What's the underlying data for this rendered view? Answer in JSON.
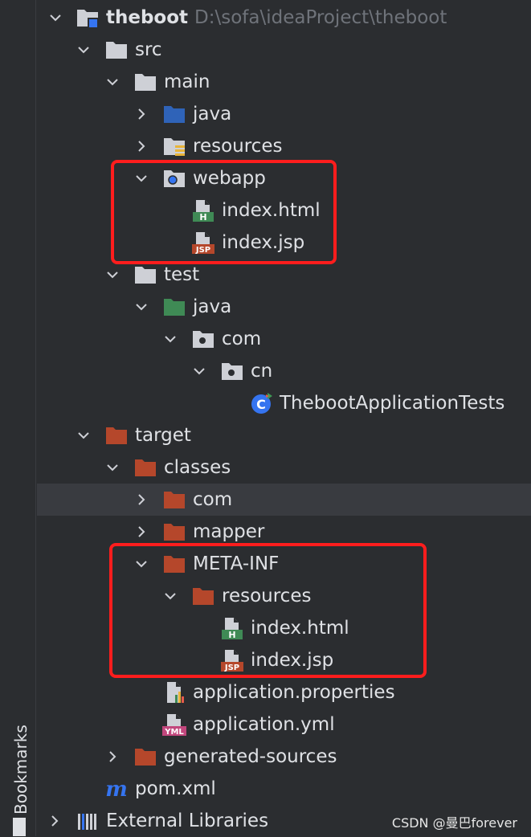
{
  "sidebar": {
    "label": "Bookmarks"
  },
  "project": {
    "name": "theboot",
    "path": "D:\\sofa\\ideaProject\\theboot"
  },
  "tree": {
    "src": "src",
    "main": "main",
    "main_java": "java",
    "resources": "resources",
    "webapp": "webapp",
    "webapp_index_html": "index.html",
    "webapp_index_jsp": "index.jsp",
    "test": "test",
    "test_java": "java",
    "com": "com",
    "cn": "cn",
    "test_class": "ThebootApplicationTests",
    "target": "target",
    "classes": "classes",
    "classes_com": "com",
    "mapper": "mapper",
    "meta_inf": "META-INF",
    "meta_resources": "resources",
    "meta_index_html": "index.html",
    "meta_index_jsp": "index.jsp",
    "app_properties": "application.properties",
    "app_yml": "application.yml",
    "generated_sources": "generated-sources",
    "pom": "pom.xml",
    "external_libraries": "External Libraries"
  },
  "icon_badges": {
    "html": "H",
    "jsp": "JSP",
    "yml": "YML",
    "maven": "m",
    "class": "C"
  },
  "watermark": "CSDN @曼巴forever",
  "colors": {
    "background": "#2b2d30",
    "selected_row": "#393b40",
    "text": "#dfe1e5",
    "path_text": "#6f737a",
    "folder_gray": "#ced0d6",
    "folder_source_blue": "#2f63b8",
    "folder_test_green": "#3f8a55",
    "folder_excluded": "#b5472b",
    "highlight_box": "#ff1d1d"
  }
}
